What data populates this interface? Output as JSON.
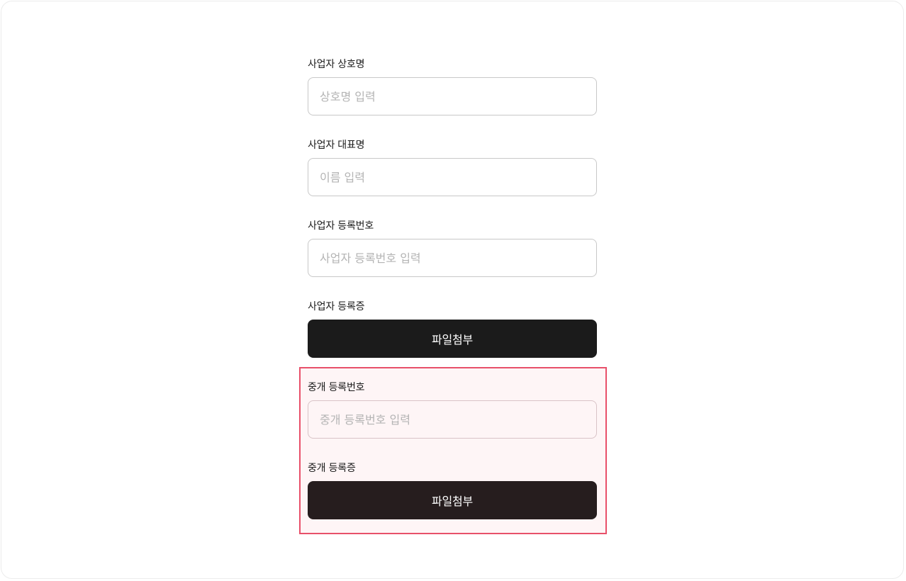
{
  "form": {
    "fields": [
      {
        "label": "사업자 상호명",
        "placeholder": "상호명 입력"
      },
      {
        "label": "사업자 대표명",
        "placeholder": "이름 입력"
      },
      {
        "label": "사업자 등록번호",
        "placeholder": "사업자 등록번호 입력"
      }
    ],
    "business_certificate": {
      "label": "사업자 등록증",
      "button_label": "파일첨부"
    },
    "broker": {
      "registration_number": {
        "label": "중개 등록번호",
        "placeholder": "중개 등록번호 입력"
      },
      "certificate": {
        "label": "중개 등록증",
        "button_label": "파일첨부"
      }
    }
  },
  "colors": {
    "highlight_border": "#e8506a",
    "button_bg": "#1b1b1b",
    "input_border": "#c8c8c8",
    "placeholder": "#b4b4b4"
  }
}
